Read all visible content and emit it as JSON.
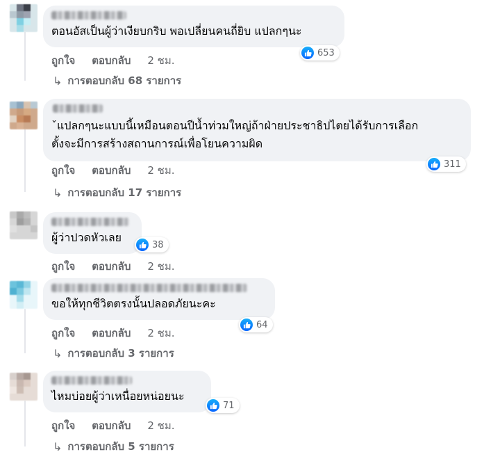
{
  "comments": [
    {
      "text_lines": [
        "ตอนอัสเป็นผู้ว่าเงียบกริบ พอเปลี่ยนคนถี่ยิบ แปลกๆนะ"
      ],
      "likes": "653",
      "like_label": "ถูกใจ",
      "reply_label": "ตอบกลับ",
      "time": "2 ชม.",
      "replies": "การตอบกลับ 68 รายการ"
    },
    {
      "text_lines": [
        "ˇแปลกๆนะแบบนี้เหมือนตอนปีน้ำท่วมใหญ่ถ้าฝ่ายประชาธิปไตยได้รับการเลือก",
        "ตั้งจะมีการสร้างสถานการณ์เพื่อโยนความผิด"
      ],
      "likes": "311",
      "like_label": "ถูกใจ",
      "reply_label": "ตอบกลับ",
      "time": "2 ชม.",
      "replies": "การตอบกลับ 17 รายการ"
    },
    {
      "text_lines": [
        "ผู้ว่าปวดหัวเลย"
      ],
      "likes": "38",
      "like_label": "ถูกใจ",
      "reply_label": "ตอบกลับ",
      "time": "2 ชม.",
      "replies": ""
    },
    {
      "text_lines": [
        "ขอให้ทุกชีวิตตรงนั้นปลอดภัยนะคะ"
      ],
      "likes": "64",
      "like_label": "ถูกใจ",
      "reply_label": "ตอบกลับ",
      "time": "2 ชม.",
      "replies": "การตอบกลับ 3 รายการ"
    },
    {
      "text_lines": [
        "ไหมบ่อยผู้ว่าเหนื่อยหน่อยนะ"
      ],
      "likes": "71",
      "like_label": "ถูกใจ",
      "reply_label": "ตอบกลับ",
      "time": "2 ชม.",
      "replies": "การตอบกลับ 5 รายการ"
    }
  ],
  "icons": {
    "like": "thumbs-up-icon",
    "reply_arrow": "reply-arrow-icon"
  },
  "colors": {
    "bubble": "#f0f2f5",
    "like_blue": "#0866ff",
    "meta_text": "#65676b"
  }
}
